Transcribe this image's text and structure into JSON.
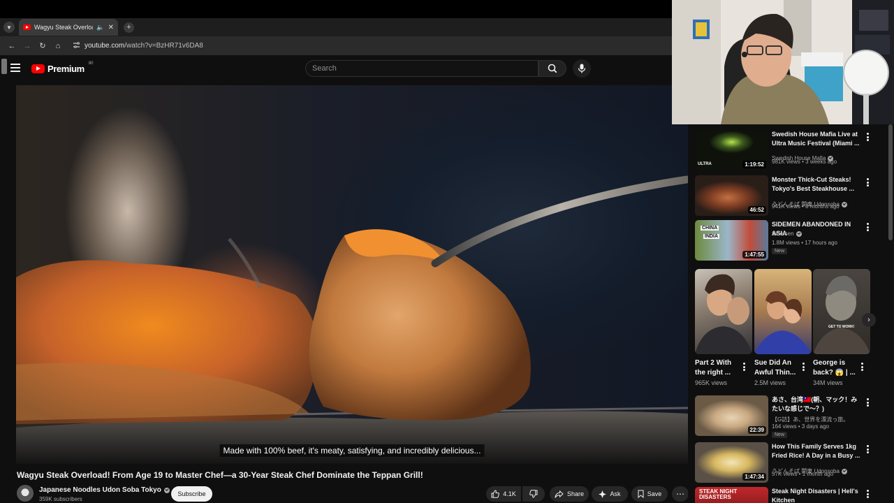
{
  "browser": {
    "tab_title": "Wagyu Steak Overload! Fro",
    "url_host": "youtube.com",
    "url_path": "/watch?v=BzHR71v6DA8"
  },
  "youtube": {
    "brand": "Premium",
    "brand_badge": "80",
    "search_placeholder": "Search"
  },
  "video": {
    "caption": "Made with 100% beef, it's meaty, satisfying, and incredibly delicious...",
    "title": "Wagyu Steak Overload! From Age 19 to Master Chef—a 30-Year Steak Chef Dominate the Teppan Grill!",
    "channel": "Japanese Noodles Udon Soba Tokyo",
    "subscribers": "359K subscribers",
    "subscribe_label": "Subscribe",
    "likes": "4.1K",
    "share_label": "Share",
    "ask_label": "Ask",
    "save_label": "Save"
  },
  "recommendations": [
    {
      "title": "Swedish House Mafia Live at Ultra Music Festival (Miami ...",
      "channel": "Swedish House Mafia",
      "verified": true,
      "meta": "981K views • 3 weeks ago",
      "duration": "1:19:52",
      "new": false
    },
    {
      "title": "Monster Thick-Cut Steaks! Tokyo's Best Steakhouse ...",
      "channel": "うどんそば 関東 Udonsoba",
      "verified": true,
      "meta": "941K views • 8 months ago",
      "duration": "46:52",
      "new": false
    },
    {
      "title": "SIDEMEN ABANDONED IN ASIA",
      "channel": "Sidemen",
      "verified": true,
      "meta": "1.8M views • 17 hours ago",
      "duration": "1:47:55",
      "new": true,
      "new_label": "New"
    }
  ],
  "shorts": [
    {
      "title": "Part 2 With the right ...",
      "views": "965K views"
    },
    {
      "title": "Sue Did An Awful Thin...",
      "views": "2.5M views"
    },
    {
      "title": "George is back? 😱 | ...",
      "views": "34M views"
    }
  ],
  "shorts_overlay_text": "GET TO WORK!",
  "recommendations_more": [
    {
      "title": "あさ、台湾🇹🇼(朝、マック！みたいな感じで〜？)",
      "channel": "【G訪】あ、世界を漂流っ旅。",
      "verified": false,
      "meta": "164 views • 3 days ago",
      "duration": "22:39",
      "new": true,
      "new_label": "New"
    },
    {
      "title": "How This Family Serves 1kg Fried Rice! A Day in a Busy ...",
      "channel": "うどんそば 関東 Udonsoba",
      "verified": true,
      "meta": "57K views • 1 month ago",
      "duration": "1:47:34",
      "new": false
    },
    {
      "title": "Steak Night Disasters | Hell's Kitchen",
      "channel": "",
      "verified": false,
      "meta": "",
      "duration": "",
      "new": false,
      "thumb_text": "STEAK NIGHT DISASTERS"
    }
  ],
  "thumb_badges": {
    "ultra": "ULTRA",
    "china": "CHINA",
    "india": "INDIA"
  },
  "colors": {
    "background": "#0f0f0f",
    "brand_red": "#ff0000",
    "text": "#f1f1f1",
    "muted": "#aaaaaa"
  }
}
